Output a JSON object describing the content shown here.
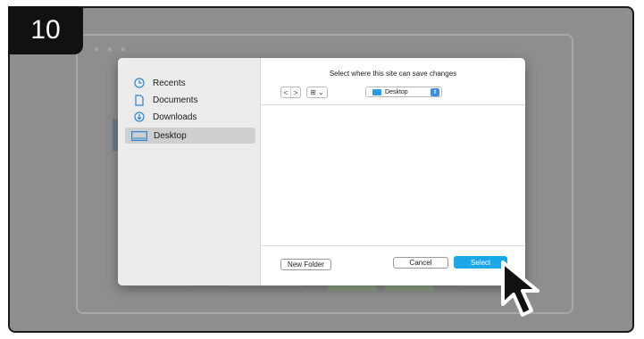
{
  "step": {
    "number": "10"
  },
  "dialog": {
    "title": "Select where this site can save changes",
    "sidebar": {
      "items": [
        {
          "label": "Recents",
          "icon": "clock-icon",
          "selected": false
        },
        {
          "label": "Documents",
          "icon": "document-icon",
          "selected": false
        },
        {
          "label": "Downloads",
          "icon": "download-icon",
          "selected": false
        },
        {
          "label": "Desktop",
          "icon": "desktop-icon",
          "selected": true
        }
      ]
    },
    "toolbar": {
      "back_glyph": "<",
      "forward_glyph": ">",
      "view_glyph": "⊞ ⌄",
      "location": "Desktop",
      "location_stepper_glyph": "⇕"
    },
    "buttons": {
      "new_folder": "New Folder",
      "cancel": "Cancel",
      "select": "Select"
    }
  },
  "colors": {
    "accent": "#1aa8e8",
    "overlay": "#8e8e8e",
    "folder": "#2a9be6"
  }
}
